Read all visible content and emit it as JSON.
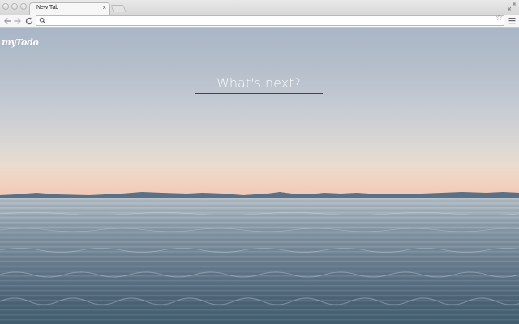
{
  "browser": {
    "tabs": [
      {
        "title": "New Tab",
        "close_glyph": "×",
        "active": true
      }
    ],
    "omnibox": {
      "value": "",
      "placeholder": ""
    },
    "bookmark_glyph": "☆"
  },
  "app": {
    "logo_text": "myTodo",
    "todo_input": {
      "value": "",
      "placeholder": "What's next?"
    }
  },
  "icons": {
    "back": "arrow-left-icon",
    "forward": "arrow-right-icon",
    "reload": "reload-icon",
    "search": "search-icon",
    "bookmark": "star-icon",
    "menu": "hamburger-menu-icon",
    "fullscreen": "fullscreen-icon"
  },
  "colors": {
    "sky_top": "#a9b6c6",
    "horizon_glow": "#f4c4b0",
    "water_deep": "#44606f",
    "input_underline": "#3b4650",
    "text_white": "#ffffff"
  }
}
